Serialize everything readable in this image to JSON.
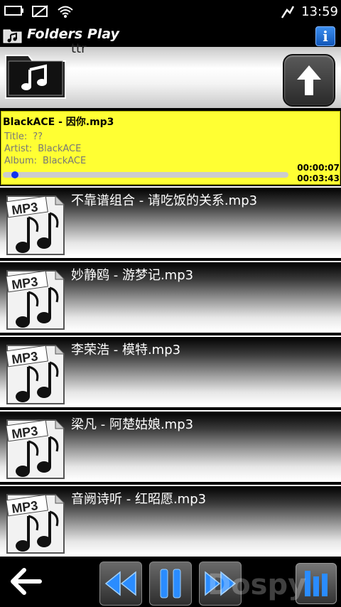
{
  "status_bar": {
    "time": "13:59",
    "icons": [
      "battery-icon",
      "no-sim-icon",
      "wifi-icon",
      "alarm-clock-icon"
    ]
  },
  "title_bar": {
    "title": "Folders Play",
    "info_label": "i"
  },
  "folder_header": {
    "partial_text": "ttr"
  },
  "now_playing": {
    "file": "BlackACE - 因你.mp3",
    "title_label": "Title:",
    "title_value": "??",
    "artist_label": "Artist:",
    "artist_value": "BlackACE",
    "album_label": "Album:",
    "album_value": "BlackACE",
    "elapsed": "00:00:07",
    "total": "00:03:43",
    "progress_fraction": 0.03,
    "progress_color": "#1133ee",
    "highlight_color": "#ffff33"
  },
  "tracks": [
    {
      "name": "不靠谱组合 - 请吃饭的关系.mp3",
      "badge": "MP3"
    },
    {
      "name": "妙静鸥 - 游梦记.mp3",
      "badge": "MP3"
    },
    {
      "name": "李荣浩 - 模特.mp3",
      "badge": "MP3"
    },
    {
      "name": "梁凡 - 阿楚姑娘.mp3",
      "badge": "MP3"
    },
    {
      "name": "音阙诗听 - 红昭愿.mp3",
      "badge": "MP3"
    }
  ],
  "controls": {
    "icons": [
      "back-arrow-icon",
      "rewind-icon",
      "pause-icon",
      "fast-forward-icon",
      "menu-icon"
    ],
    "accent": "#2a8cff"
  },
  "watermark": "Dospy"
}
